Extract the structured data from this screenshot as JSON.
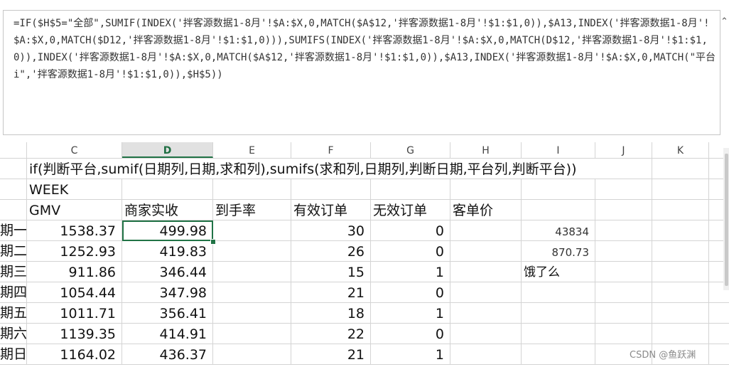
{
  "formula_bar": {
    "text": "=IF($H$5=\"全部\",SUMIF(INDEX('拌客源数据1-8月'!$A:$X,0,MATCH($A$12,'拌客源数据1-8月'!$1:$1,0)),$A13,INDEX('拌客源数据1-8月'!$A:$X,0,MATCH($D12,'拌客源数据1-8月'!$1:$1,0))),SUMIFS(INDEX('拌客源数据1-8月'!$A:$X,0,MATCH(D$12,'拌客源数据1-8月'!$1:$1,0)),INDEX('拌客源数据1-8月'!$A:$X,0,MATCH($A$12,'拌客源数据1-8月'!$1:$1,0)),$A13,INDEX('拌客源数据1-8月'!$A:$X,0,MATCH(\"平台i\",'拌客源数据1-8月'!$1:$1,0)),$H$5))",
    "collapse_icon": "chevron-up-icon"
  },
  "columns": [
    "C",
    "D",
    "E",
    "F",
    "G",
    "H",
    "I",
    "J",
    "K"
  ],
  "active_column": "D",
  "rows": {
    "note": "if(判断平台,sumif(日期列,日期,求和列),sumifs(求和列,日期列,判断日期,平台列,判断平台))",
    "week_label": "WEEK",
    "headers": {
      "c": "GMV",
      "d": "商家实收",
      "e": "到手率",
      "f": "有效订单",
      "g": "无效订单",
      "h": "客单价"
    },
    "data": [
      {
        "day": "期一",
        "gmv": "1538.37",
        "net": "499.98",
        "valid": "30",
        "invalid": "0",
        "i": "43834"
      },
      {
        "day": "期二",
        "gmv": "1252.93",
        "net": "419.83",
        "valid": "26",
        "invalid": "0",
        "i": "870.73"
      },
      {
        "day": "期三",
        "gmv": "911.86",
        "net": "346.44",
        "valid": "15",
        "invalid": "1",
        "i": "饿了么"
      },
      {
        "day": "期四",
        "gmv": "1054.44",
        "net": "347.98",
        "valid": "21",
        "invalid": "0",
        "i": ""
      },
      {
        "day": "期五",
        "gmv": "1011.71",
        "net": "356.41",
        "valid": "18",
        "invalid": "1",
        "i": ""
      },
      {
        "day": "期六",
        "gmv": "1139.35",
        "net": "414.91",
        "valid": "22",
        "invalid": "0",
        "i": ""
      },
      {
        "day": "期日",
        "gmv": "1164.02",
        "net": "436.37",
        "valid": "21",
        "invalid": "1",
        "i": ""
      }
    ]
  },
  "watermark": "CSDN @鱼跃渊",
  "colors": {
    "accent": "#217346"
  }
}
